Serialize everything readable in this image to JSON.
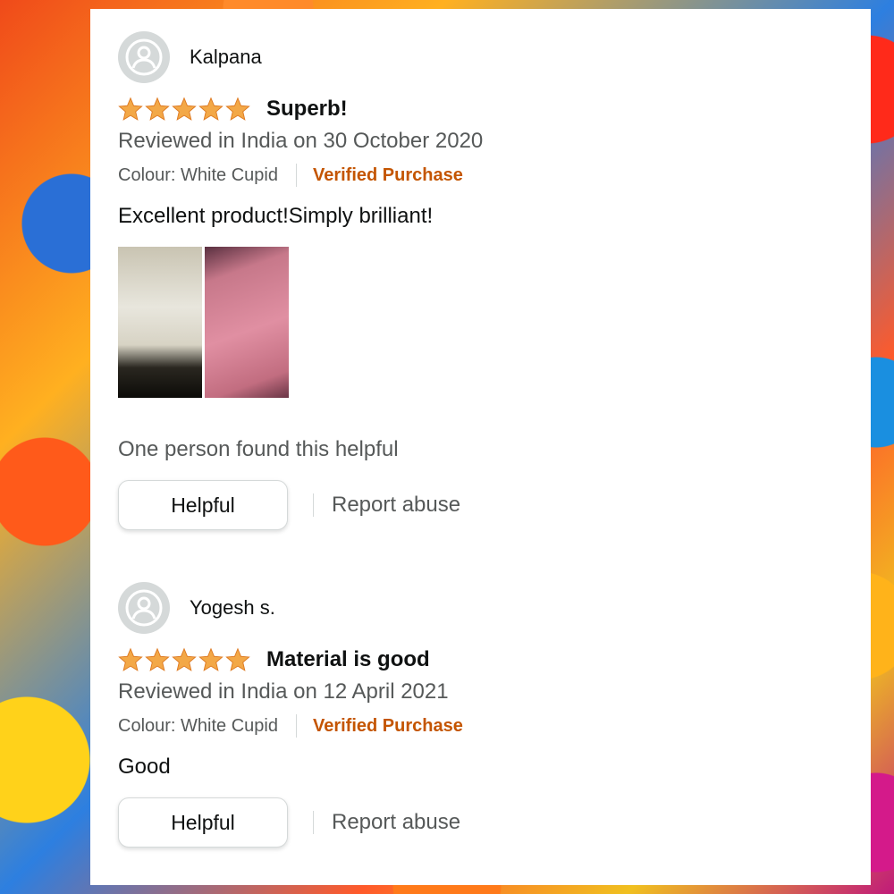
{
  "reviews": [
    {
      "reviewer": "Kalpana",
      "rating": 5,
      "max_rating": 5,
      "title": "Superb!",
      "date": "Reviewed in India on 30 October 2020",
      "colour": "Colour: White Cupid",
      "verified": "Verified Purchase",
      "body": "Excellent product!Simply brilliant!",
      "helpful_count": "One person found this helpful",
      "helpful_label": "Helpful",
      "report_label": "Report abuse"
    },
    {
      "reviewer": "Yogesh s.",
      "rating": 5,
      "max_rating": 5,
      "title": "Material is good",
      "date": "Reviewed in India on 12 April 2021",
      "colour": "Colour: White Cupid",
      "verified": "Verified Purchase",
      "body": "Good",
      "helpful_label": "Helpful",
      "report_label": "Report abuse"
    }
  ],
  "colors": {
    "star": "#f3a847",
    "verified": "#c45500",
    "secondary_text": "#565959",
    "primary_text": "#0f1111"
  },
  "icons": {
    "avatar": "user-avatar-icon",
    "star": "star-icon"
  }
}
